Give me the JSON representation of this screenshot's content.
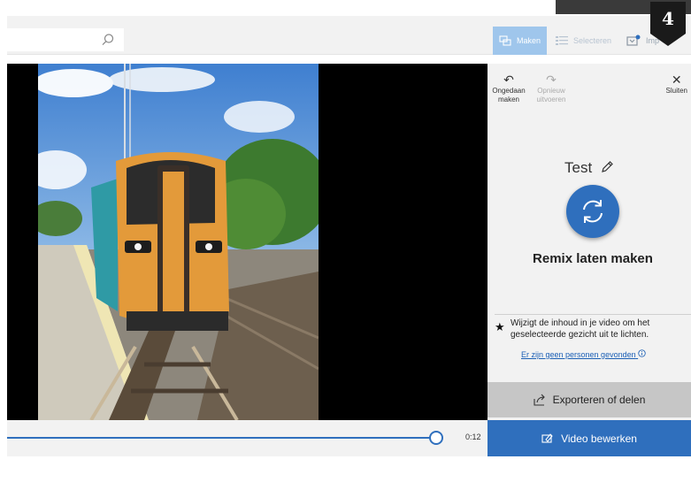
{
  "toolbar": {
    "maken_label": "Maken",
    "selecteren_label": "Selecteren",
    "importeren_label": "Imp",
    "search_placeholder": ""
  },
  "badge": {
    "number": "4",
    "color": "#1a1a1a"
  },
  "panel": {
    "undo_label": "Ongedaan maken",
    "redo_label": "Opnieuw uitvoeren",
    "close_label": "Sluiten",
    "title": "Test",
    "remix_label": "Remix laten maken",
    "info_text": "Wijzigt de inhoud in je video om het geselecteerde gezicht uit te lichten.",
    "no_people_link": "Er zijn geen personen gevonden",
    "export_label": "Exporteren of delen",
    "edit_label": "Video bewerken"
  },
  "playback": {
    "time": "0:12",
    "progress": 0.9
  },
  "colors": {
    "accent": "#2f6fbd",
    "panel_bg": "#f2f2f2",
    "export_bg": "#c6c6c6"
  },
  "icons": [
    "search-icon",
    "maken-icon",
    "selecteren-icon",
    "importeren-icon",
    "undo-icon",
    "redo-icon",
    "close-icon",
    "pencil-icon",
    "remix-icon",
    "star-icon",
    "info-icon",
    "export-icon",
    "edit-video-icon"
  ]
}
